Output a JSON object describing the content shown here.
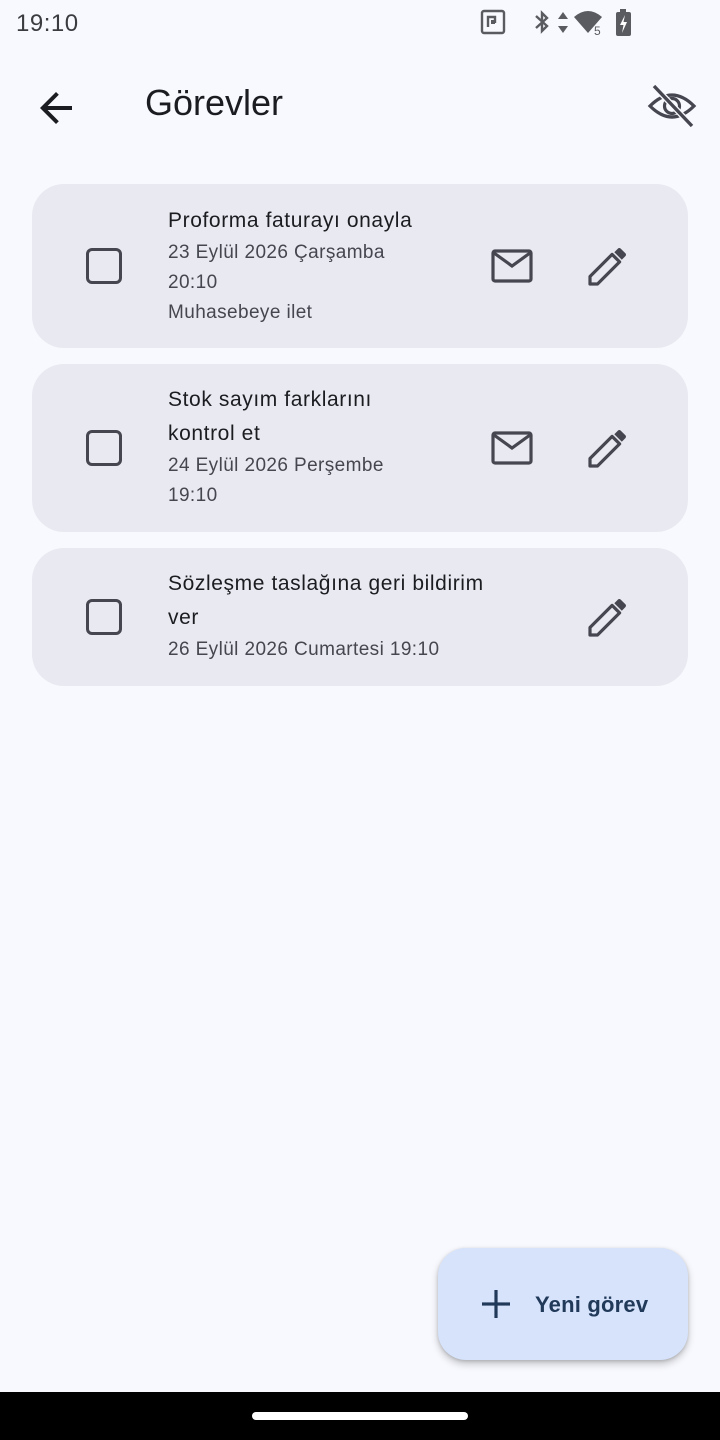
{
  "status_bar": {
    "time": "19:10",
    "icons": [
      "nfc-icon",
      "bluetooth-icon",
      "data-arrows-icon",
      "wifi-icon",
      "battery-charging-icon"
    ],
    "wifi_badge": "5"
  },
  "app_bar": {
    "title": "Görevler",
    "back_icon": "arrow-back-icon",
    "action_icon": "visibility-off-icon"
  },
  "tasks": [
    {
      "title_lines": [
        "Proforma faturayı onayla"
      ],
      "meta_lines": [
        "23 Eylül 2026 Çarşamba",
        "20:10",
        "Muhasebeye ilet"
      ],
      "checked": false,
      "has_mail": true
    },
    {
      "title_lines": [
        "Stok sayım farklarını",
        "kontrol et"
      ],
      "meta_lines": [
        "24 Eylül 2026 Perşembe",
        "19:10"
      ],
      "checked": false,
      "has_mail": true
    },
    {
      "title_lines": [
        "Sözleşme taslağına geri bildirim",
        "ver"
      ],
      "meta_lines": [
        "26 Eylül 2026 Cumartesi 19:10"
      ],
      "checked": false,
      "has_mail": false
    }
  ],
  "fab": {
    "label": "Yeni görev",
    "icon": "add-icon"
  },
  "colors": {
    "background": "#f8f9fe",
    "card": "#e9eaf1",
    "fab": "#d6e3fb",
    "fab_text": "#223a5a"
  }
}
